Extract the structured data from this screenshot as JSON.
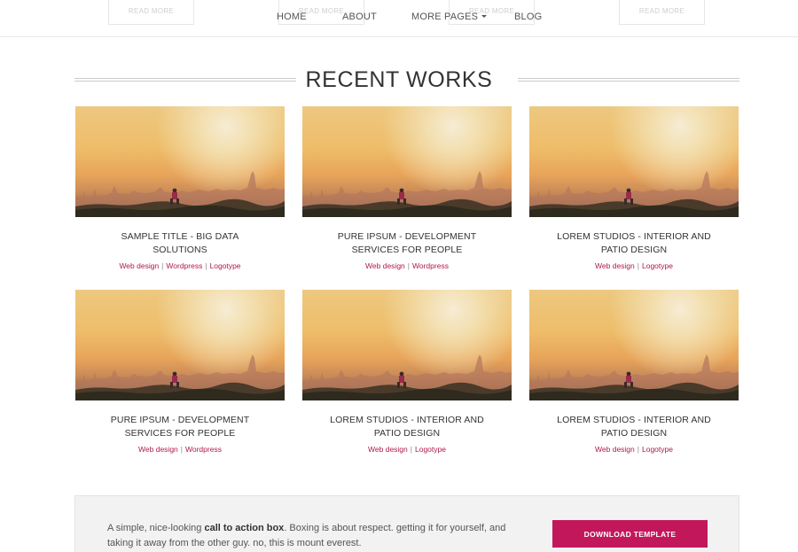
{
  "ghost_buttons": [
    "READ MORE",
    "READ MORE",
    "READ MORE",
    "READ MORE"
  ],
  "nav": {
    "items": [
      {
        "label": "HOME"
      },
      {
        "label": "ABOUT"
      },
      {
        "label": "MORE PAGES"
      },
      {
        "label": "BLOG"
      }
    ]
  },
  "section": {
    "title": "RECENT WORKS"
  },
  "works": [
    {
      "title": "SAMPLE TITLE - BIG DATA SOLUTIONS",
      "tags": [
        "Web design",
        "Wordpress",
        "Logotype"
      ]
    },
    {
      "title": "PURE IPSUM - DEVELOPMENT SERVICES FOR PEOPLE",
      "tags": [
        "Web design",
        "Wordpress"
      ]
    },
    {
      "title": "LOREM STUDIOS - INTERIOR AND PATIO DESIGN",
      "tags": [
        "Web design",
        "Logotype"
      ]
    },
    {
      "title": "PURE IPSUM - DEVELOPMENT SERVICES FOR PEOPLE",
      "tags": [
        "Web design",
        "Wordpress"
      ]
    },
    {
      "title": "LOREM STUDIOS - INTERIOR AND PATIO DESIGN",
      "tags": [
        "Web design",
        "Logotype"
      ]
    },
    {
      "title": "LOREM STUDIOS - INTERIOR AND PATIO DESIGN",
      "tags": [
        "Web design",
        "Logotype"
      ]
    }
  ],
  "cta": {
    "text_before": "A simple, nice-looking ",
    "text_bold": "call to action box",
    "text_after": ". Boxing is about respect. getting it for yourself, and taking it away from the other guy. no, this is mount everest.",
    "button_label": "DOWNLOAD TEMPLATE"
  },
  "colors": {
    "accent": "#c2185b",
    "tag": "#b0184a"
  }
}
